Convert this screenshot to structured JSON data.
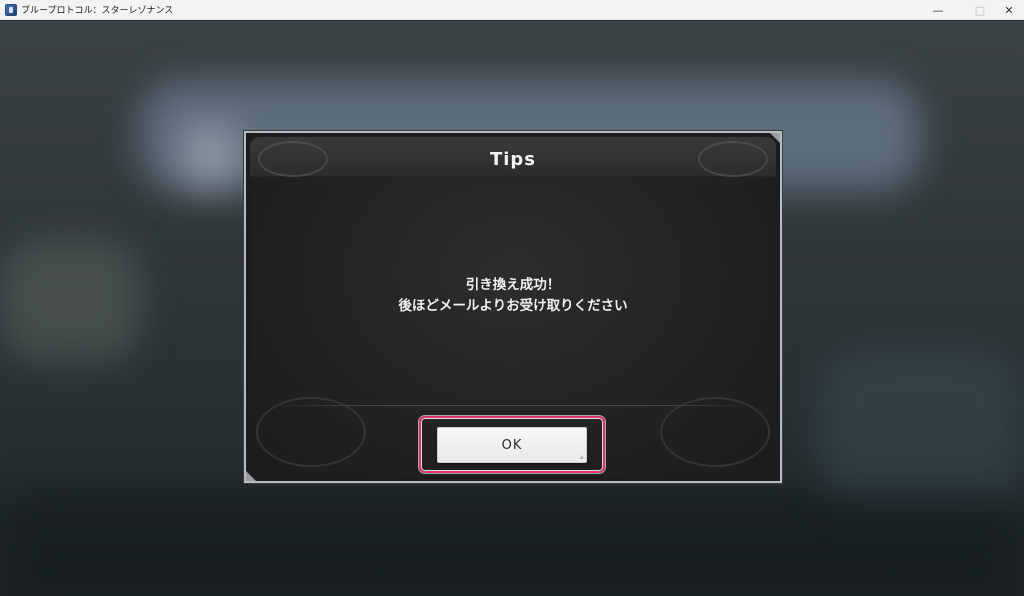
{
  "window": {
    "title": "ブループロトコル：スターレゾナンス",
    "icon": "app-icon",
    "controls": {
      "minimize": "—",
      "maximize": "□",
      "close": "✕"
    }
  },
  "dialog": {
    "title": "Tips",
    "message_line1": "引き換え成功！",
    "message_line2": "後ほどメールよりお受け取りください",
    "ok_label": "OK"
  },
  "colors": {
    "highlight": "#e0356f",
    "dialog_bg": "#222223",
    "button_bg": "#f0f0f0"
  }
}
